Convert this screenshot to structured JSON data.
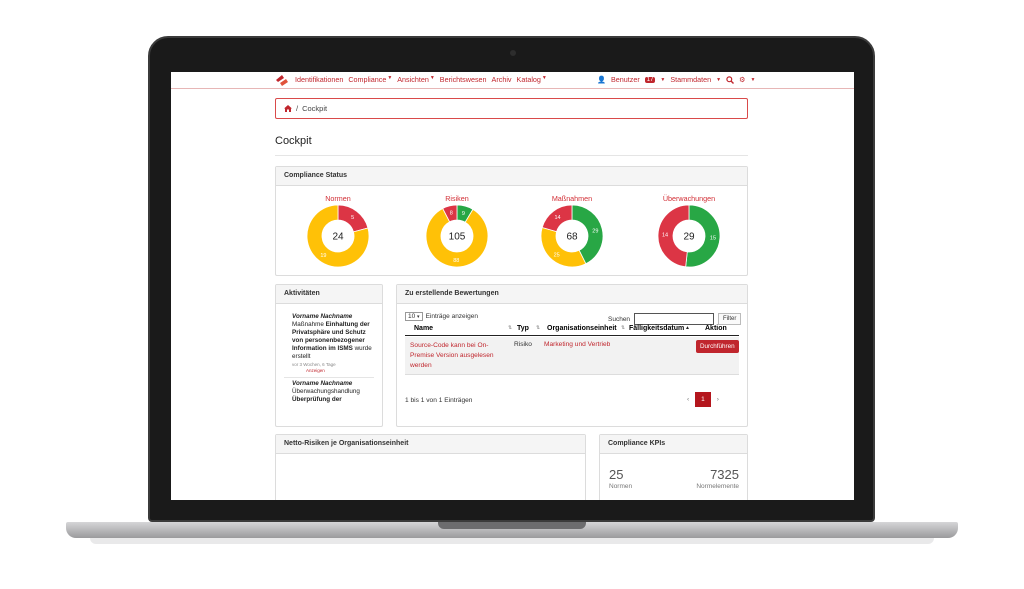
{
  "nav": {
    "left": [
      "Identifikationen",
      "Compliance",
      "Ansichten",
      "Berichtswesen",
      "Archiv",
      "Katalog"
    ],
    "left_has_caret": [
      false,
      true,
      true,
      false,
      false,
      true
    ],
    "user_label": "Benutzer",
    "badge": "17",
    "stammdaten": "Stammdaten"
  },
  "breadcrumb": {
    "current": "Cockpit"
  },
  "page_title": "Cockpit",
  "compliance_panel": {
    "title": "Compliance Status"
  },
  "donuts": [
    {
      "label": "Normen",
      "total": "24",
      "segments": [
        {
          "value": 5,
          "label": "5",
          "color": "#dc3545"
        },
        {
          "value": 19,
          "label": "19",
          "color": "#ffc107"
        }
      ]
    },
    {
      "label": "Risiken",
      "total": "105",
      "segments": [
        {
          "value": 9,
          "label": "9",
          "color": "#28a745"
        },
        {
          "value": 88,
          "label": "88",
          "color": "#ffc107"
        },
        {
          "value": 8,
          "label": "8",
          "color": "#dc3545"
        }
      ]
    },
    {
      "label": "Maßnahmen",
      "total": "68",
      "segments": [
        {
          "value": 29,
          "label": "29",
          "color": "#28a745"
        },
        {
          "value": 25,
          "label": "25",
          "color": "#ffc107"
        },
        {
          "value": 14,
          "label": "14",
          "color": "#dc3545"
        }
      ]
    },
    {
      "label": "Überwachungen",
      "total": "29",
      "segments": [
        {
          "value": 15,
          "label": "15",
          "color": "#28a745"
        },
        {
          "value": 14,
          "label": "14",
          "color": "#dc3545"
        }
      ]
    }
  ],
  "activities": {
    "title": "Aktivitäten",
    "item1": {
      "name": "Vorname Nachname",
      "prefix": "Maßnahme",
      "bold": "Einhaltung der Privatsphäre und Schutz von personenbezogener Information im ISMS",
      "suffix": "wurde erstellt",
      "time": "vor 3 Wochen, 6 Tage",
      "link": "Anzeigen"
    },
    "item2": {
      "name": "Vorname Nachname",
      "prefix": "Überwachungshandlung",
      "bold": "Überprüfung der"
    }
  },
  "assessments": {
    "title": "Zu erstellende Bewertungen",
    "page_size": "10",
    "entries_label": "Einträge anzeigen",
    "search_label": "Suchen",
    "filter_button": "Filter",
    "columns": [
      "Name",
      "Typ",
      "Organisationseinheit",
      "Fälligkeitsdatum",
      "Aktion"
    ],
    "row": {
      "name": "Source-Code kann bei On-Premise Version ausgelesen werden",
      "typ": "Risiko",
      "org": "Marketing und Vertrieb",
      "date": "",
      "action": "Durchführen"
    },
    "info": "1 bis 1 von 1 Einträgen",
    "pagination": [
      "‹",
      "1",
      "›"
    ]
  },
  "netto": {
    "title": "Netto-Risiken je Organisationseinheit"
  },
  "kpis": {
    "title": "Compliance KPIs",
    "a_value": "25",
    "a_label": "Normen",
    "b_value": "7325",
    "b_label": "Normelemente"
  }
}
